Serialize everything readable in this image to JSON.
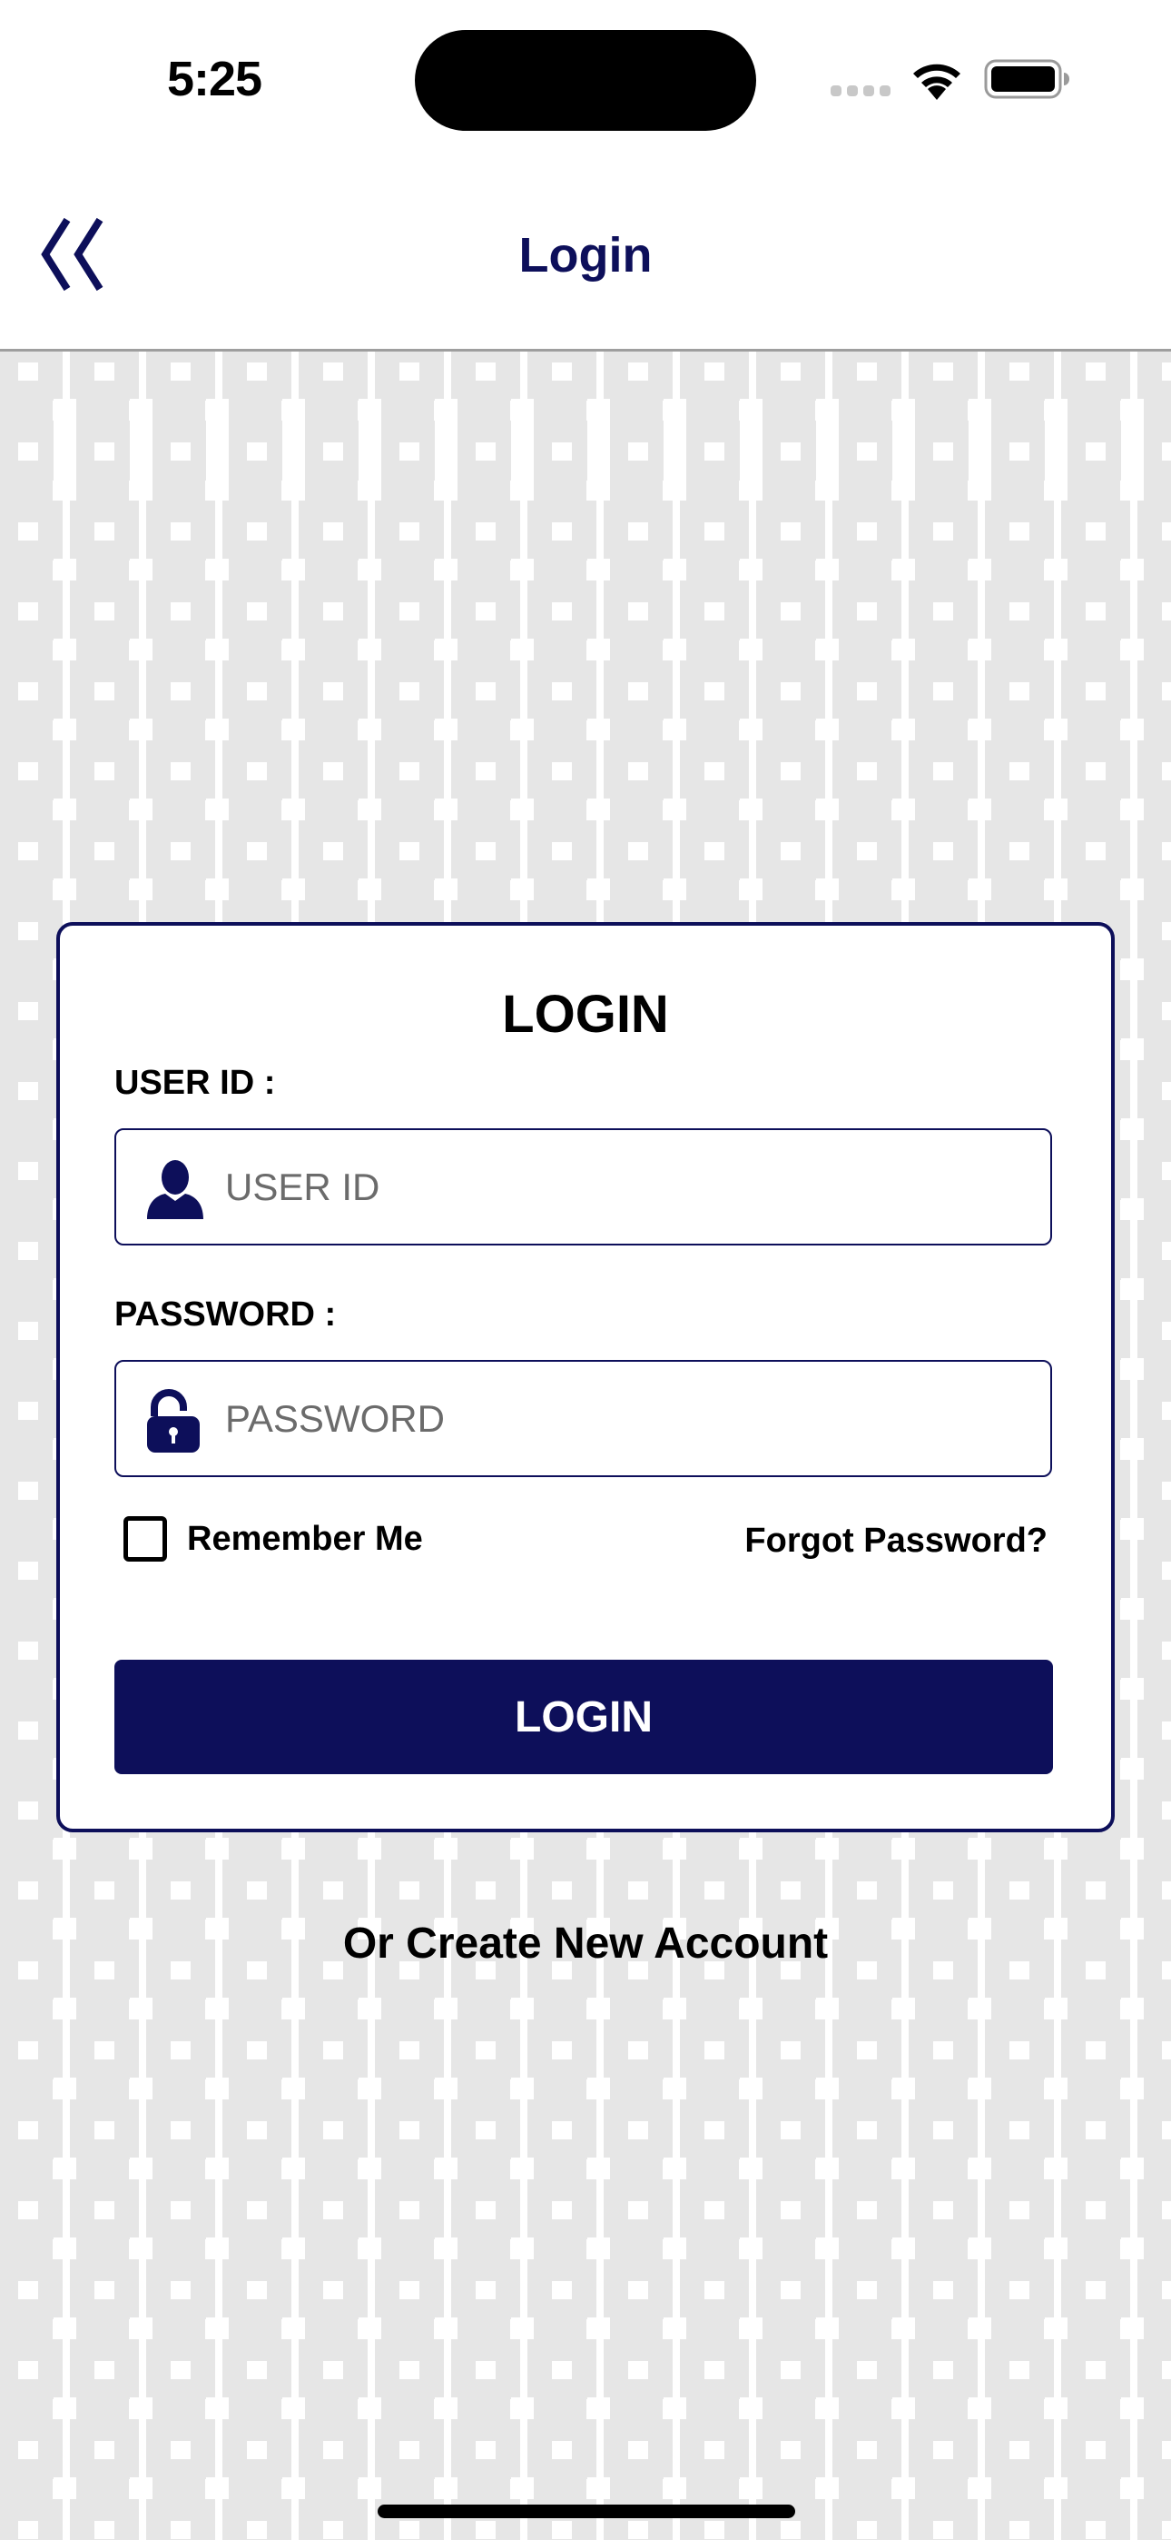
{
  "status_bar": {
    "time": "5:25",
    "icons": [
      "cellular-signal-icon",
      "wifi-icon",
      "battery-icon"
    ]
  },
  "nav": {
    "title": "Login",
    "back_icon": "double-chevron-left-icon"
  },
  "form": {
    "title": "LOGIN",
    "user_id": {
      "label": "USER ID :",
      "placeholder": "USER ID",
      "value": "",
      "icon": "user-icon"
    },
    "password": {
      "label": "PASSWORD :",
      "placeholder": "PASSWORD",
      "value": "",
      "icon": "unlock-icon"
    },
    "remember_me": {
      "label": "Remember Me",
      "checked": false
    },
    "forgot_password_label": "Forgot Password?",
    "submit_label": "LOGIN"
  },
  "create_account_label": "Or Create New Account",
  "colors": {
    "primary": "#0d0f5a",
    "background": "#e6e6e6",
    "placeholder": "#6b6b6b"
  }
}
